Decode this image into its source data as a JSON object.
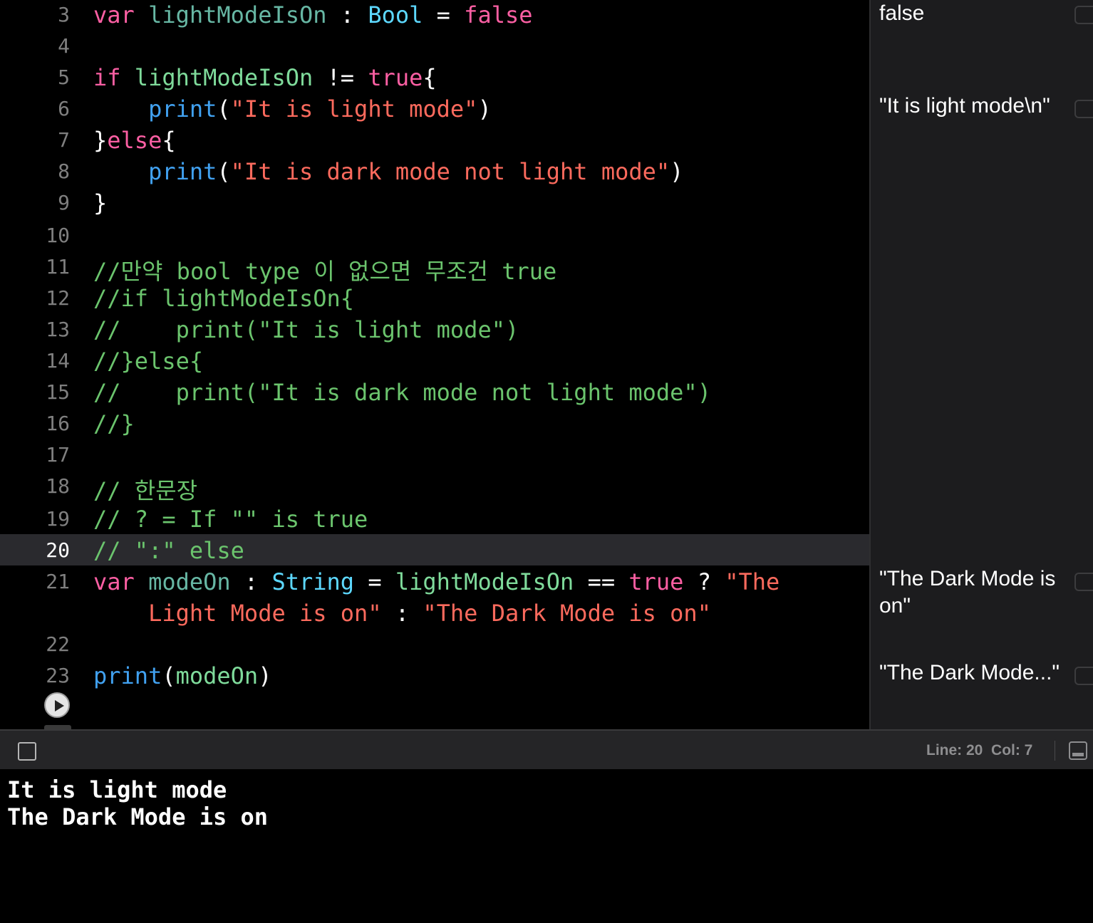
{
  "editor": {
    "current_line": "20",
    "lines": [
      {
        "num": "3",
        "tokens": [
          [
            "kw",
            "var"
          ],
          [
            "pl",
            " "
          ],
          [
            "id",
            "lightModeIsOn"
          ],
          [
            "pl",
            " : "
          ],
          [
            "ty",
            "Bool"
          ],
          [
            "pl",
            " = "
          ],
          [
            "kw",
            "false"
          ]
        ]
      },
      {
        "num": "4",
        "tokens": []
      },
      {
        "num": "5",
        "tokens": [
          [
            "kw",
            "if"
          ],
          [
            "pl",
            " "
          ],
          [
            "idp",
            "lightModeIsOn"
          ],
          [
            "pl",
            " != "
          ],
          [
            "kw",
            "true"
          ],
          [
            "pl",
            "{"
          ]
        ]
      },
      {
        "num": "6",
        "tokens": [
          [
            "pl",
            "    "
          ],
          [
            "fn",
            "print"
          ],
          [
            "pl",
            "("
          ],
          [
            "str",
            "\"It is light mode\""
          ],
          [
            "pl",
            ")"
          ]
        ]
      },
      {
        "num": "7",
        "tokens": [
          [
            "pl",
            "}"
          ],
          [
            "kw",
            "else"
          ],
          [
            "pl",
            "{"
          ]
        ]
      },
      {
        "num": "8",
        "tokens": [
          [
            "pl",
            "    "
          ],
          [
            "fn",
            "print"
          ],
          [
            "pl",
            "("
          ],
          [
            "str",
            "\"It is dark mode not light mode\""
          ],
          [
            "pl",
            ")"
          ]
        ]
      },
      {
        "num": "9",
        "tokens": [
          [
            "pl",
            "}"
          ]
        ]
      },
      {
        "num": "10",
        "tokens": []
      },
      {
        "num": "11",
        "tokens": [
          [
            "cm",
            "//만약 bool type 이 없으면 무조건 true"
          ]
        ]
      },
      {
        "num": "12",
        "tokens": [
          [
            "cm",
            "//if lightModeIsOn{"
          ]
        ]
      },
      {
        "num": "13",
        "tokens": [
          [
            "cm",
            "//    print(\"It is light mode\")"
          ]
        ]
      },
      {
        "num": "14",
        "tokens": [
          [
            "cm",
            "//}else{"
          ]
        ]
      },
      {
        "num": "15",
        "tokens": [
          [
            "cm",
            "//    print(\"It is dark mode not light mode\")"
          ]
        ]
      },
      {
        "num": "16",
        "tokens": [
          [
            "cm",
            "//}"
          ]
        ]
      },
      {
        "num": "17",
        "tokens": []
      },
      {
        "num": "18",
        "tokens": [
          [
            "cm",
            "// 한문장"
          ]
        ]
      },
      {
        "num": "19",
        "tokens": [
          [
            "cm",
            "// ? = If \"\" is true"
          ]
        ]
      },
      {
        "num": "20",
        "tokens": [
          [
            "cm",
            "// \":\" else"
          ]
        ]
      },
      {
        "num": "21",
        "tokens": [
          [
            "kw",
            "var"
          ],
          [
            "pl",
            " "
          ],
          [
            "id",
            "modeOn"
          ],
          [
            "pl",
            " : "
          ],
          [
            "ty",
            "String"
          ],
          [
            "pl",
            " = "
          ],
          [
            "idp",
            "lightModeIsOn"
          ],
          [
            "pl",
            " == "
          ],
          [
            "kw",
            "true"
          ],
          [
            "pl",
            " ? "
          ],
          [
            "str",
            "\"The"
          ]
        ]
      },
      {
        "num": "",
        "tokens": [
          [
            "pl",
            "    "
          ],
          [
            "str",
            "Light Mode is on\""
          ],
          [
            "pl",
            " : "
          ],
          [
            "str",
            "\"The Dark Mode is on\""
          ]
        ]
      },
      {
        "num": "22",
        "tokens": []
      },
      {
        "num": "23",
        "tokens": [
          [
            "fn",
            "print"
          ],
          [
            "pl",
            "("
          ],
          [
            "idp",
            "modeOn"
          ],
          [
            "pl",
            ")"
          ]
        ]
      }
    ]
  },
  "results": [
    {
      "text": "false"
    },
    {
      "text": "\"It is light mode\\n\""
    },
    {
      "text": "\"The Dark Mode is on\""
    },
    {
      "text": "\"The Dark Mode...\""
    }
  ],
  "status": {
    "line_col": "Line: 20  Col: 7"
  },
  "console": {
    "lines": [
      "It is light mode",
      "The Dark Mode is on"
    ]
  }
}
